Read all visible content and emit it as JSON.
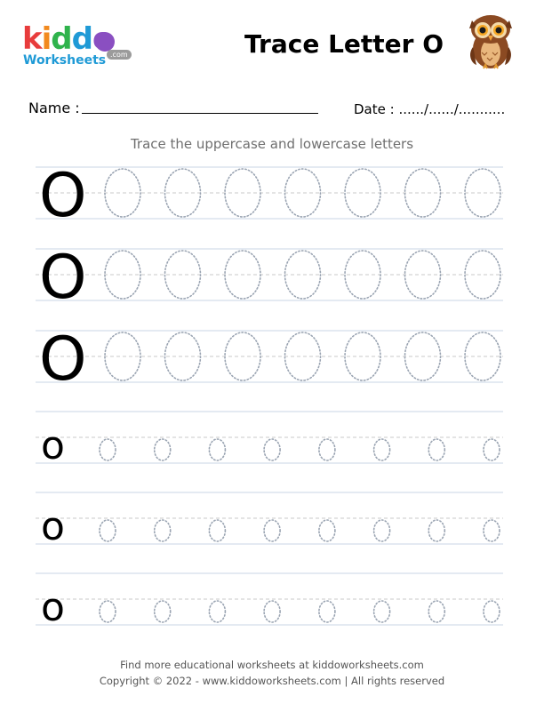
{
  "brand": {
    "name": "kiddo",
    "sub": "Worksheets",
    "domain": ".com",
    "colors": [
      "#e83c3c",
      "#f28a1f",
      "#2fb34c",
      "#1f9ad6",
      "#8a4fc1"
    ]
  },
  "title": "Trace Letter O",
  "form": {
    "name_label": "Name :",
    "date_label": "Date : ....../....../..........."
  },
  "instruction": "Trace the uppercase and lowercase letters",
  "rows": [
    {
      "model": "O",
      "case": "upper",
      "trace_count": 7
    },
    {
      "model": "O",
      "case": "upper",
      "trace_count": 7
    },
    {
      "model": "O",
      "case": "upper",
      "trace_count": 7
    },
    {
      "model": "o",
      "case": "lower",
      "trace_count": 8
    },
    {
      "model": "o",
      "case": "lower",
      "trace_count": 8
    },
    {
      "model": "o",
      "case": "lower",
      "trace_count": 8
    }
  ],
  "footer": {
    "line1": "Find more educational worksheets at kiddoworksheets.com",
    "line2": "Copyright © 2022 - www.kiddoworksheets.com  |  All rights reserved"
  },
  "colors": {
    "guide_line": "#c9d6e6",
    "dashed_line": "#c8c8c8",
    "trace_dots": "#9aa4b2",
    "instruction_text": "#6f6f6f"
  }
}
